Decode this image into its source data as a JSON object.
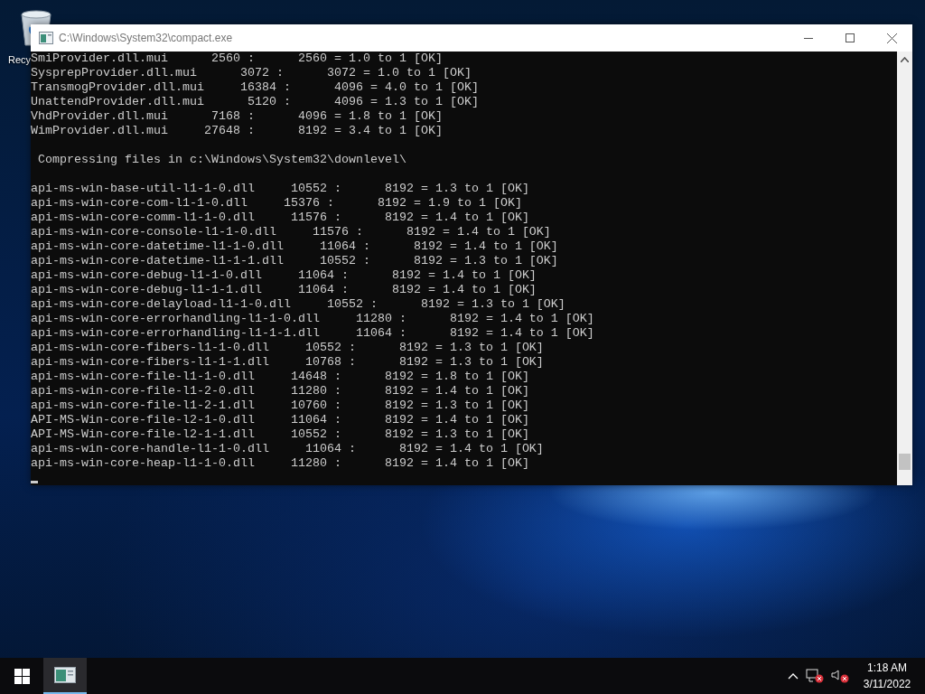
{
  "desktop": {
    "icons": [
      {
        "label": "Recy"
      }
    ]
  },
  "window": {
    "title": "C:\\Windows\\System32\\compact.exe",
    "lines": [
      {
        "kind": "output",
        "text": "SmiProvider.dll.mui      2560 :      2560 = 1.0 to 1 [OK]"
      },
      {
        "kind": "output",
        "text": "SysprepProvider.dll.mui      3072 :      3072 = 1.0 to 1 [OK]"
      },
      {
        "kind": "output",
        "text": "TransmogProvider.dll.mui     16384 :      4096 = 4.0 to 1 [OK]"
      },
      {
        "kind": "output",
        "text": "UnattendProvider.dll.mui      5120 :      4096 = 1.3 to 1 [OK]"
      },
      {
        "kind": "output",
        "text": "VhdProvider.dll.mui      7168 :      4096 = 1.8 to 1 [OK]"
      },
      {
        "kind": "output",
        "text": "WimProvider.dll.mui     27648 :      8192 = 3.4 to 1 [OK]"
      },
      {
        "kind": "heading",
        "text": " Compressing files in c:\\Windows\\System32\\downlevel\\"
      },
      {
        "kind": "output",
        "text": "api-ms-win-base-util-l1-1-0.dll     10552 :      8192 = 1.3 to 1 [OK]"
      },
      {
        "kind": "output",
        "text": "api-ms-win-core-com-l1-1-0.dll     15376 :      8192 = 1.9 to 1 [OK]"
      },
      {
        "kind": "output",
        "text": "api-ms-win-core-comm-l1-1-0.dll     11576 :      8192 = 1.4 to 1 [OK]"
      },
      {
        "kind": "output",
        "text": "api-ms-win-core-console-l1-1-0.dll     11576 :      8192 = 1.4 to 1 [OK]"
      },
      {
        "kind": "output",
        "text": "api-ms-win-core-datetime-l1-1-0.dll     11064 :      8192 = 1.4 to 1 [OK]"
      },
      {
        "kind": "output",
        "text": "api-ms-win-core-datetime-l1-1-1.dll     10552 :      8192 = 1.3 to 1 [OK]"
      },
      {
        "kind": "output",
        "text": "api-ms-win-core-debug-l1-1-0.dll     11064 :      8192 = 1.4 to 1 [OK]"
      },
      {
        "kind": "output",
        "text": "api-ms-win-core-debug-l1-1-1.dll     11064 :      8192 = 1.4 to 1 [OK]"
      },
      {
        "kind": "output",
        "text": "api-ms-win-core-delayload-l1-1-0.dll     10552 :      8192 = 1.3 to 1 [OK]"
      },
      {
        "kind": "output",
        "text": "api-ms-win-core-errorhandling-l1-1-0.dll     11280 :      8192 = 1.4 to 1 [OK]"
      },
      {
        "kind": "output",
        "text": "api-ms-win-core-errorhandling-l1-1-1.dll     11064 :      8192 = 1.4 to 1 [OK]"
      },
      {
        "kind": "output",
        "text": "api-ms-win-core-fibers-l1-1-0.dll     10552 :      8192 = 1.3 to 1 [OK]"
      },
      {
        "kind": "output",
        "text": "api-ms-win-core-fibers-l1-1-1.dll     10768 :      8192 = 1.3 to 1 [OK]"
      },
      {
        "kind": "output",
        "text": "api-ms-win-core-file-l1-1-0.dll     14648 :      8192 = 1.8 to 1 [OK]"
      },
      {
        "kind": "output",
        "text": "api-ms-win-core-file-l1-2-0.dll     11280 :      8192 = 1.4 to 1 [OK]"
      },
      {
        "kind": "output",
        "text": "api-ms-win-core-file-l1-2-1.dll     10760 :      8192 = 1.3 to 1 [OK]"
      },
      {
        "kind": "output",
        "text": "API-MS-Win-core-file-l2-1-0.dll     11064 :      8192 = 1.4 to 1 [OK]"
      },
      {
        "kind": "output",
        "text": "API-MS-Win-core-file-l2-1-1.dll     10552 :      8192 = 1.3 to 1 [OK]"
      },
      {
        "kind": "output",
        "text": "api-ms-win-core-handle-l1-1-0.dll     11064 :      8192 = 1.4 to 1 [OK]"
      },
      {
        "kind": "output",
        "text": "api-ms-win-core-heap-l1-1-0.dll     11280 :      8192 = 1.4 to 1 [OK]"
      }
    ]
  },
  "taskbar": {
    "time": "1:18 AM",
    "date": "3/11/2022"
  }
}
